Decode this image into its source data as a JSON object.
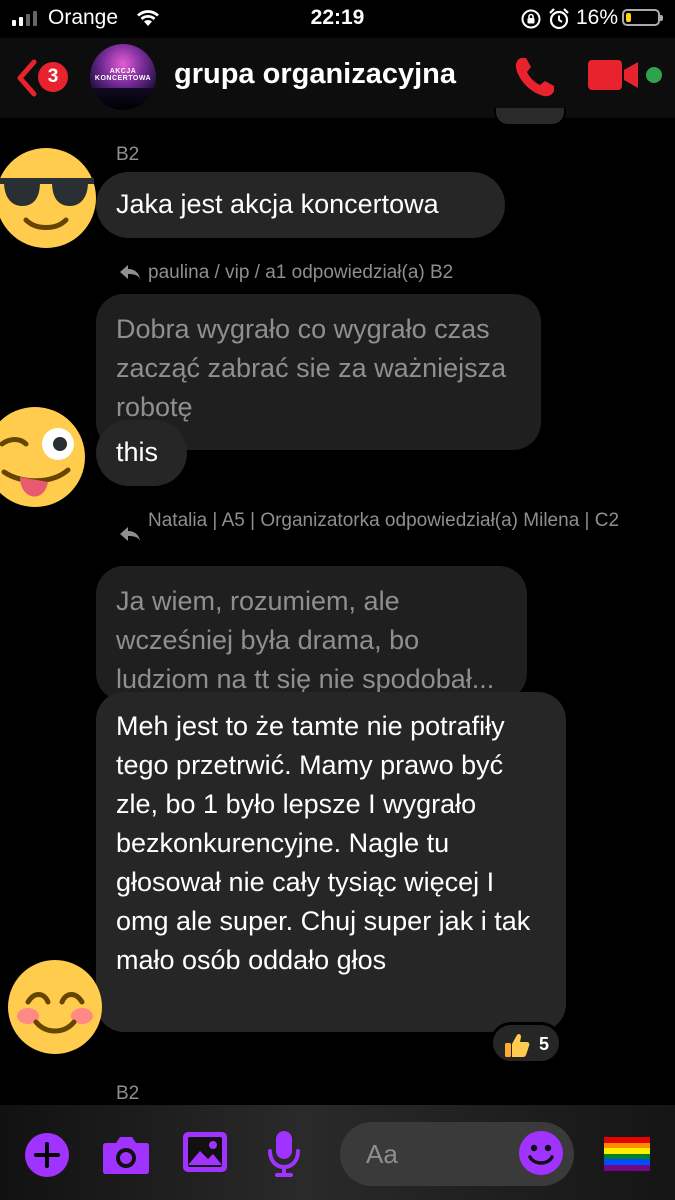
{
  "status_bar": {
    "carrier": "Orange",
    "time": "22:19",
    "battery_percent": "16%",
    "battery_level": 0.16,
    "icons": [
      "signal-icon",
      "wifi-icon",
      "rotation-lock-icon",
      "alarm-icon",
      "battery-icon"
    ]
  },
  "header": {
    "back_badge": "3",
    "avatar_text": "AKCJA KONCERTOWA",
    "title": "grupa organizacyjna",
    "icons": [
      "back-chevron-icon",
      "phone-icon",
      "video-camera-icon",
      "online-dot-icon"
    ]
  },
  "messages": [
    {
      "sender": "B2",
      "text": "Jaka jest akcja koncertowa",
      "avatar": "sunglasses-emoji"
    },
    {
      "reply_header": "paulina / vip / a1 odpowiedział(a) B2",
      "quoted": "Dobra wygrało co wygrało czas zacząć zabrać sie za ważniejsza robotę",
      "text": "this",
      "avatar": "winking-tongue-emoji"
    },
    {
      "reply_header": "Natalia | A5 | Organizatorka odpowiedział(a) Milena | C2",
      "quoted": "Ja wiem, rozumiem, ale wcześniej była drama, bo ludziom na tt się nie spodobał...",
      "text": "Meh jest to że tamte nie potrafiły tego przetrwić. Mamy prawo być zle, bo 1 było lepsze I wygrało bezkonkurencyjne. Nagle tu głosował nie cały tysiąc więcej I omg ale super. Chuj super jak i tak mało osób oddało głos",
      "reaction": {
        "emoji": "thumbs-up",
        "count": "5"
      },
      "avatar": "smiling-blush-emoji"
    }
  ],
  "next_sender": "B2",
  "composer": {
    "placeholder": "Aa",
    "buttons": [
      "plus-icon",
      "camera-icon",
      "gallery-icon",
      "microphone-icon",
      "emoji-icon",
      "rainbow-flag-icon"
    ]
  },
  "colors": {
    "accent": "#a033ff",
    "danger": "#e8232d",
    "bubble": "#262626",
    "online": "#31a24c"
  }
}
